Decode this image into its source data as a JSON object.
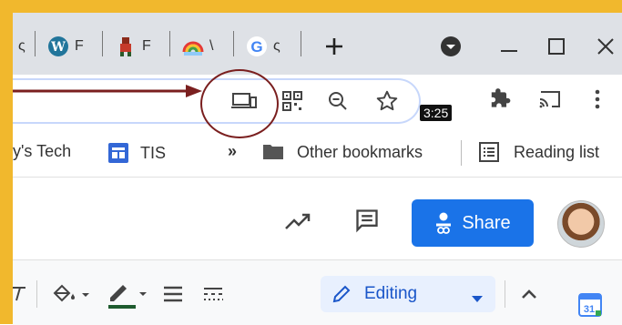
{
  "tabs": [
    {
      "label": "ς",
      "icon": "tab-favicon-partial"
    },
    {
      "label": "F",
      "icon": "wordpress-icon"
    },
    {
      "label": "F",
      "icon": "character-favicon-icon"
    },
    {
      "label": "\\",
      "icon": "rainbow-favicon-icon"
    },
    {
      "label": "ς",
      "icon": "google-icon"
    }
  ],
  "toolbar": {
    "timestamp_badge": "3:25"
  },
  "bookmarks": {
    "item1": "y's Tech",
    "item2": "TIS",
    "overflow": "»",
    "other": "Other bookmarks",
    "reading": "Reading list"
  },
  "doc": {
    "share_label": "Share",
    "editing_label": "Editing"
  },
  "colors": {
    "frame": "#f1b82d",
    "accent": "#1a73e8",
    "annotation": "#7a1f1f"
  }
}
